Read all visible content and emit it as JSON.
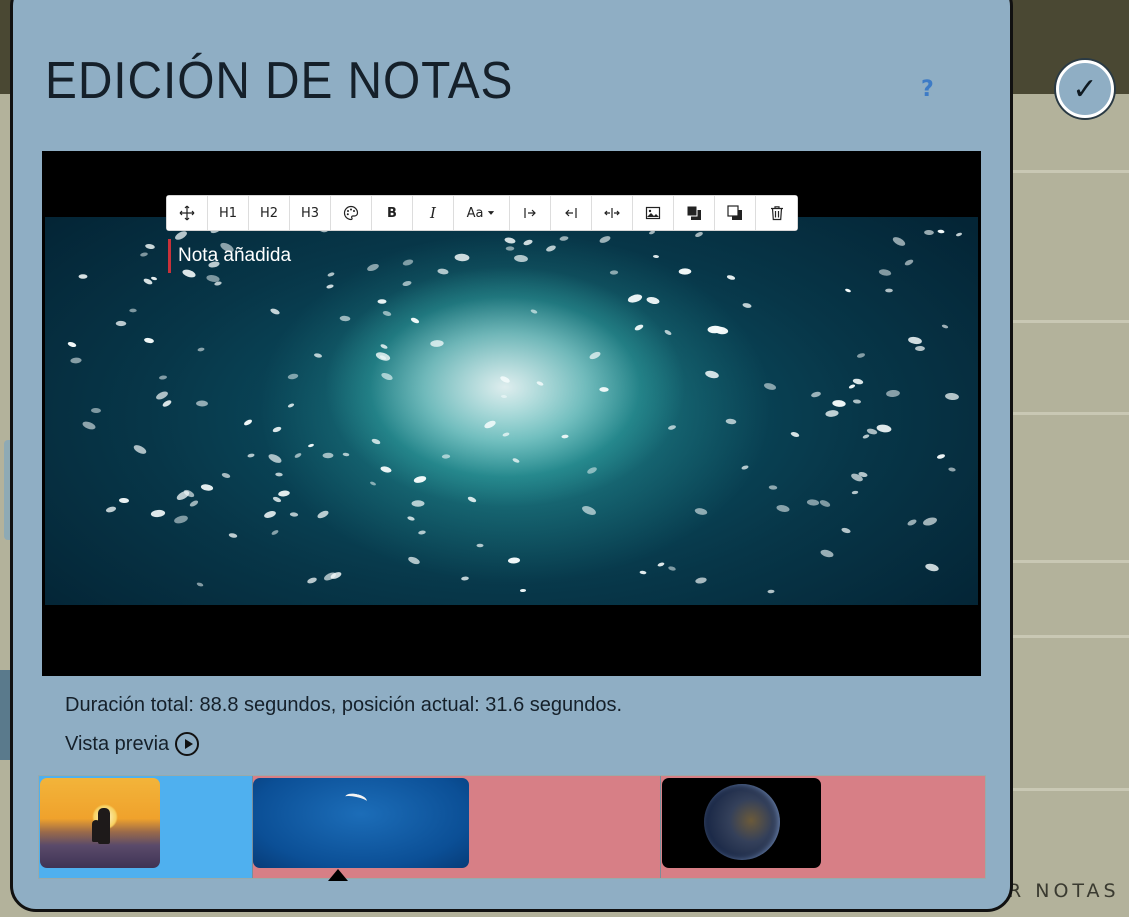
{
  "modal": {
    "title": "EDICIÓN DE NOTAS",
    "help_icon": "question-mark-icon",
    "help_label": "?"
  },
  "confirm": {
    "icon": "checkmark-icon",
    "label": "✓"
  },
  "toolbar": {
    "move_icon": "move-icon",
    "h1_label": "H1",
    "h2_label": "H2",
    "h3_label": "H3",
    "color_icon": "palette-icon",
    "bold_label": "B",
    "italic_label": "I",
    "font_size_label": "Aa",
    "font_size_icon": "caret-down-icon",
    "align_right_icon": "arrow-to-right-bar-icon",
    "align_left_icon": "arrow-to-left-bar-icon",
    "expand_icon": "expand-horizontal-icon",
    "image_icon": "image-icon",
    "bring_front_icon": "bring-to-front-icon",
    "send_back_icon": "send-to-back-icon",
    "delete_icon": "trash-icon"
  },
  "note": {
    "text": "Nota añadida"
  },
  "status": {
    "duration_text": "Duración total: 88.8 segundos, posición actual: 31.6 segundos."
  },
  "preview": {
    "label": "Vista previa",
    "icon": "play-circle-icon"
  },
  "timeline": {
    "segments": [
      {
        "color": "#4fb0ef",
        "thumbnail": "sunset-silhouette-thumbnail"
      },
      {
        "color": "#d77f86",
        "thumbnail": "blue-sky-bird-thumbnail"
      },
      {
        "color": "#d77f86",
        "thumbnail": "earth-at-night-thumbnail"
      }
    ],
    "marker_icon": "triangle-up-icon"
  },
  "background": {
    "footer_text": "R NOTAS"
  },
  "colors": {
    "modal_bg": "#8faec4",
    "accent_blue": "#4fb0ef",
    "segment_pink": "#d77f86",
    "note_marker": "#c8323a",
    "help_blue": "#3d7bc6"
  }
}
